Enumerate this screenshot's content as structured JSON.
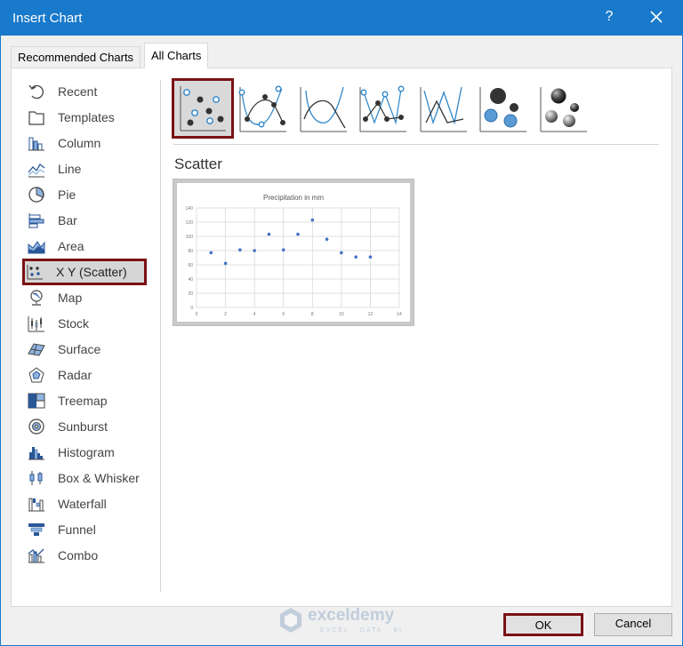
{
  "window": {
    "title": "Insert Chart",
    "help_label": "?"
  },
  "tabs": [
    {
      "label": "Recommended Charts",
      "active": false
    },
    {
      "label": "All Charts",
      "active": true
    }
  ],
  "sidebar": {
    "items": [
      {
        "label": "Recent",
        "icon": "recent-icon"
      },
      {
        "label": "Templates",
        "icon": "templates-icon"
      },
      {
        "label": "Column",
        "icon": "column-chart-icon"
      },
      {
        "label": "Line",
        "icon": "line-chart-icon"
      },
      {
        "label": "Pie",
        "icon": "pie-chart-icon"
      },
      {
        "label": "Bar",
        "icon": "bar-chart-icon"
      },
      {
        "label": "Area",
        "icon": "area-chart-icon"
      },
      {
        "label": "X Y (Scatter)",
        "icon": "scatter-chart-icon",
        "selected": true
      },
      {
        "label": "Map",
        "icon": "map-chart-icon"
      },
      {
        "label": "Stock",
        "icon": "stock-chart-icon"
      },
      {
        "label": "Surface",
        "icon": "surface-chart-icon"
      },
      {
        "label": "Radar",
        "icon": "radar-chart-icon"
      },
      {
        "label": "Treemap",
        "icon": "treemap-chart-icon"
      },
      {
        "label": "Sunburst",
        "icon": "sunburst-chart-icon"
      },
      {
        "label": "Histogram",
        "icon": "histogram-chart-icon"
      },
      {
        "label": "Box & Whisker",
        "icon": "box-whisker-chart-icon"
      },
      {
        "label": "Waterfall",
        "icon": "waterfall-chart-icon"
      },
      {
        "label": "Funnel",
        "icon": "funnel-chart-icon"
      },
      {
        "label": "Combo",
        "icon": "combo-chart-icon"
      }
    ]
  },
  "subtypes": [
    {
      "icon": "scatter-icon",
      "selected": true
    },
    {
      "icon": "scatter-smooth-lines-markers-icon"
    },
    {
      "icon": "scatter-smooth-lines-icon"
    },
    {
      "icon": "scatter-straight-lines-markers-icon"
    },
    {
      "icon": "scatter-straight-lines-icon"
    },
    {
      "icon": "bubble-icon"
    },
    {
      "icon": "3d-bubble-icon"
    }
  ],
  "selected_subtype_name": "Scatter",
  "preview": {
    "chart_data": {
      "type": "scatter",
      "title": "Precipitation in mm",
      "xlabel": "",
      "ylabel": "",
      "xlim": [
        0,
        14
      ],
      "ylim": [
        0,
        140
      ],
      "x_ticks": [
        "0",
        "2",
        "4",
        "6",
        "8",
        "10",
        "12",
        "14"
      ],
      "y_ticks": [
        "0",
        "20",
        "40",
        "60",
        "80",
        "100",
        "120",
        "140"
      ],
      "grid": true,
      "series": [
        {
          "x": [
            1,
            2,
            3,
            4,
            5,
            6,
            7,
            8,
            9,
            10,
            11,
            12
          ],
          "y": [
            77,
            62,
            81,
            80,
            103,
            81,
            103,
            123,
            96,
            77,
            71,
            71
          ],
          "color": "#4472c4"
        }
      ]
    }
  },
  "watermark": {
    "brand": "exceldemy",
    "tagline": "EXCEL · DATA · BI"
  },
  "buttons": {
    "ok": "OK",
    "cancel": "Cancel"
  },
  "colors": {
    "titlebar": "#1979ca",
    "selection_border": "#7b1114",
    "series": "#4472c4"
  }
}
